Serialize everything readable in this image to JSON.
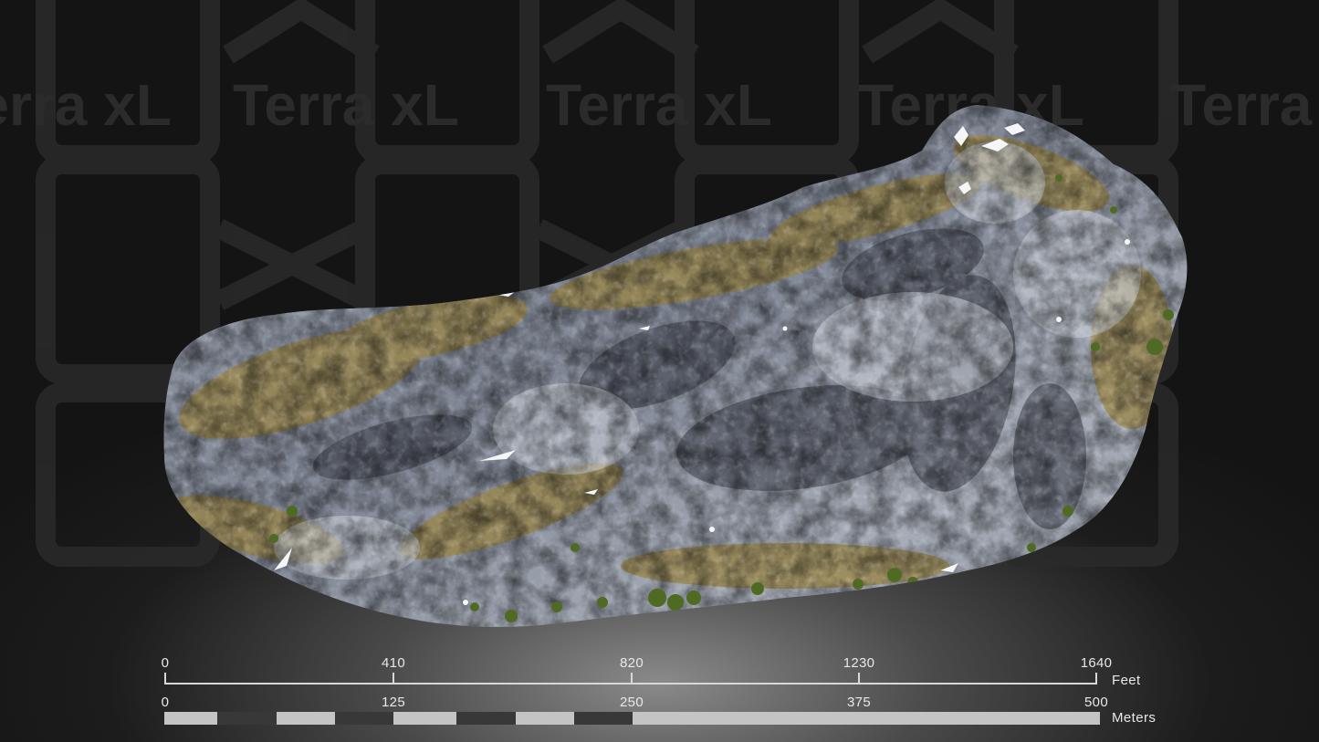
{
  "watermark": {
    "text": "Terra xL"
  },
  "scale_bar": {
    "feet": {
      "ticks": [
        "0",
        "410",
        "820",
        "1230",
        "1640"
      ],
      "unit": "Feet"
    },
    "meters": {
      "ticks": [
        "0",
        "125",
        "250",
        "375",
        "500"
      ],
      "unit": "Meters"
    }
  },
  "colors": {
    "background": "#161616",
    "rock": "#8f96a3",
    "moss": "#9a8445",
    "vegetation": "#4f6a22",
    "snow": "#f4f6f8",
    "scale_light": "#c4c4c4",
    "scale_dark": "#383838"
  }
}
